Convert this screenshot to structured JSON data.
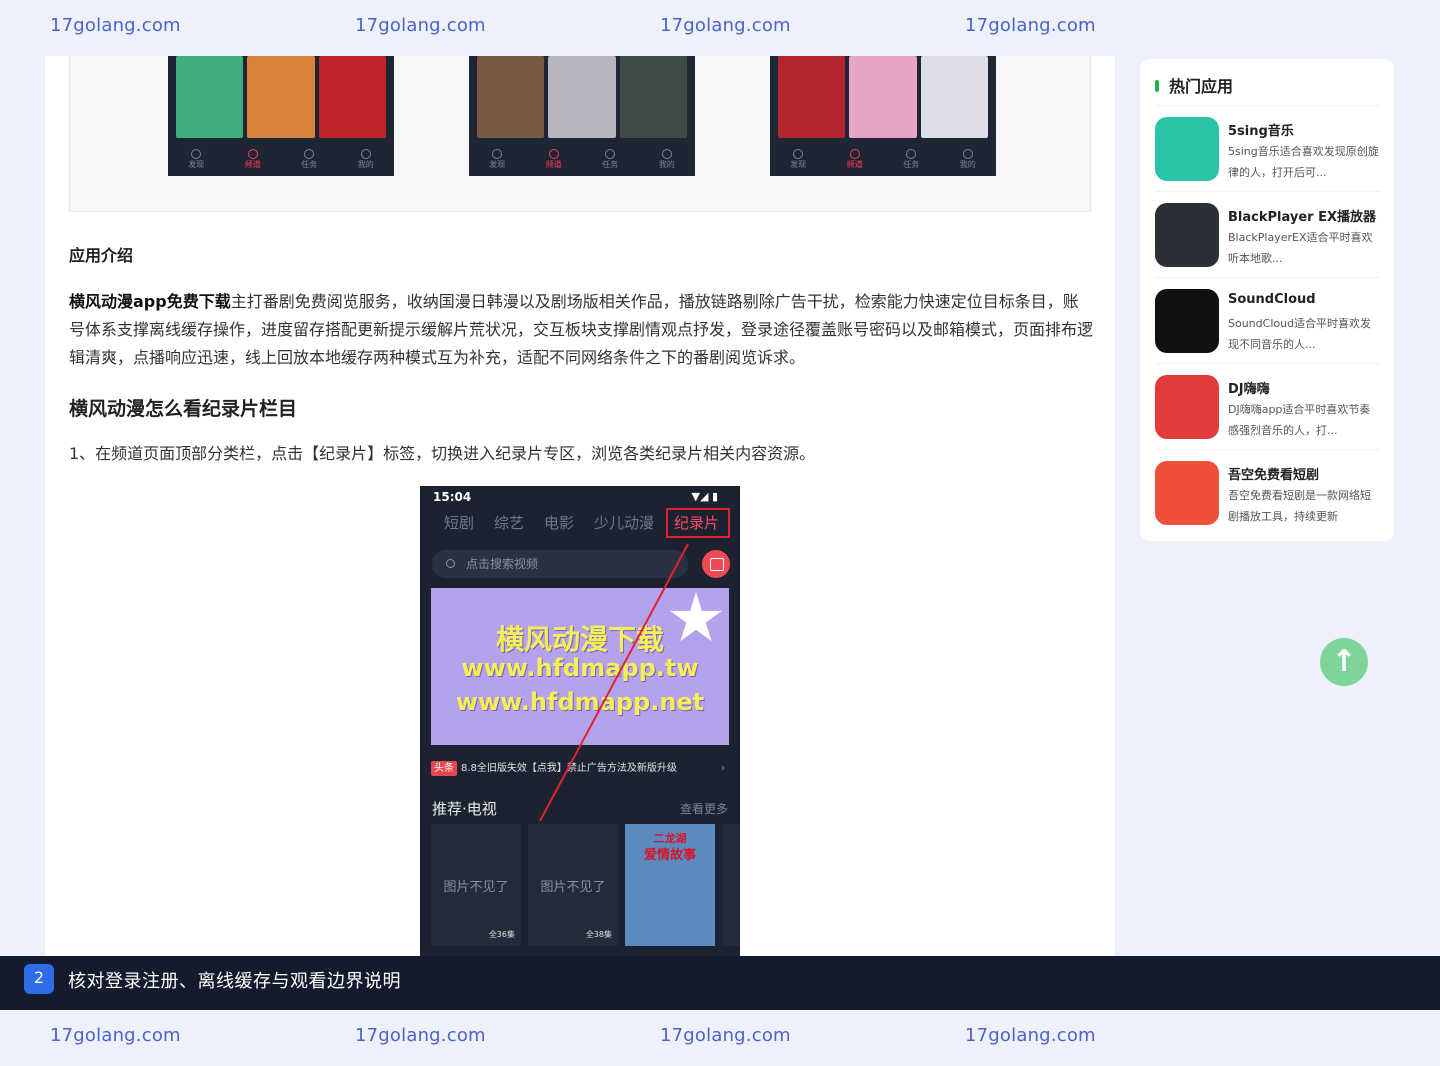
{
  "watermark": {
    "text": "17golang.com"
  },
  "top_shots": [
    {
      "tabs": [
        "发现",
        "频道",
        "任务",
        "我的"
      ],
      "active": 1,
      "poster_colors": [
        "#3fae7a",
        "#d8843c",
        "#c0262c"
      ]
    },
    {
      "tabs": [
        "发现",
        "频道",
        "任务",
        "我的"
      ],
      "active": 1,
      "poster_colors": [
        "#7a5a45",
        "#b8b4be",
        "#3e4a46"
      ]
    },
    {
      "tabs": [
        "发现",
        "频道",
        "任务",
        "我的"
      ],
      "active": 1,
      "poster_colors": [
        "#b3242c",
        "#e6a4c8",
        "#dcdde6"
      ]
    }
  ],
  "article": {
    "intro_title": "应用介绍",
    "intro_bold": "横风动漫app免费下载",
    "intro_text": "主打番剧免费阅览服务，收纳国漫日韩漫以及剧场版相关作品，播放链路剔除广告干扰，检索能力快速定位目标条目，账号体系支撑离线缓存操作，进度留存搭配更新提示缓解片荒状况，交互板块支撑剧情观点抒发，登录途径覆盖账号密码以及邮箱模式，页面排布逻辑清爽，点播响应迅速，线上回放本地缓存两种模式互为补充，适配不同网络条件之下的番剧阅览诉求。",
    "section_title": "横风动漫怎么看纪录片栏目",
    "step1": "1、在频道页面顶部分类栏，点击【纪录片】标签，切换进入纪录片专区，浏览各类纪录片相关内容资源。"
  },
  "phone": {
    "time": "15:04",
    "status_right": "▼◢ ▮",
    "categories": [
      "短剧",
      "综艺",
      "电影",
      "少儿动漫",
      "纪录片"
    ],
    "search_placeholder": "点击搜索视频",
    "banner_line1": "横风动漫下载",
    "banner_line2": "www.hfdmapp.tw",
    "banner_line3": "www.hfdmapp.net",
    "news_tag": "头条",
    "news_text": "8.8全旧版失效【点我】禁止广告方法及新版升级",
    "rec_title": "推荐·电视",
    "more": "查看更多",
    "missing": "图片不见了",
    "card1_eps": "全36集",
    "card2_eps": "全38集",
    "poster_t1": "二龙湖",
    "poster_t2": "爱情故事"
  },
  "sidebar": {
    "title": "热门应用",
    "apps": [
      {
        "name": "5sing音乐",
        "desc": "5sing音乐适合喜欢发现原创旋律的人，打开后可...",
        "icon": "5sing-icon",
        "color": "#2bc4a4"
      },
      {
        "name": "BlackPlayer EX播放器",
        "desc": "BlackPlayerEX适合平时喜欢听本地歌...",
        "icon": "blackplayer-icon",
        "color": "#2a2f38"
      },
      {
        "name": "SoundCloud",
        "desc": "SoundCloud适合平时喜欢发现不同音乐的人...",
        "icon": "soundcloud-icon",
        "color": "#111111"
      },
      {
        "name": "DJ嗨嗨",
        "desc": "DJ嗨嗨app适合平时喜欢节奏感强烈音乐的人，打...",
        "icon": "dj-icon",
        "color": "#e23b3b"
      },
      {
        "name": "吾空免费看短剧",
        "desc": "吾空免费看短剧是一款网络短剧播放工具，持续更新",
        "icon": "wukong-icon",
        "color": "#f0503a"
      }
    ]
  },
  "toc": {
    "number": "2",
    "text": "核对登录注册、离线缓存与观看边界说明"
  },
  "to_top": {
    "icon": "arrow-up-icon",
    "glyph": "↑"
  }
}
